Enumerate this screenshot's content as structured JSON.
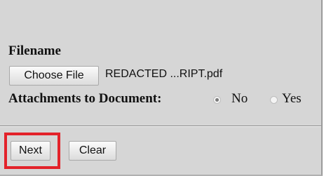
{
  "form": {
    "filename_label": "Filename",
    "choose_file_label": "Choose File",
    "selected_file": "REDACTED ...RIPT.pdf",
    "attachments_label": "Attachments to Document:",
    "attachments_options": [
      {
        "label": "No",
        "selected": true
      },
      {
        "label": "Yes",
        "selected": false
      }
    ]
  },
  "actions": {
    "next_label": "Next",
    "clear_label": "Clear",
    "highlight_color": "#e3222a"
  },
  "colors": {
    "panel_background": "#d6d6d6"
  }
}
